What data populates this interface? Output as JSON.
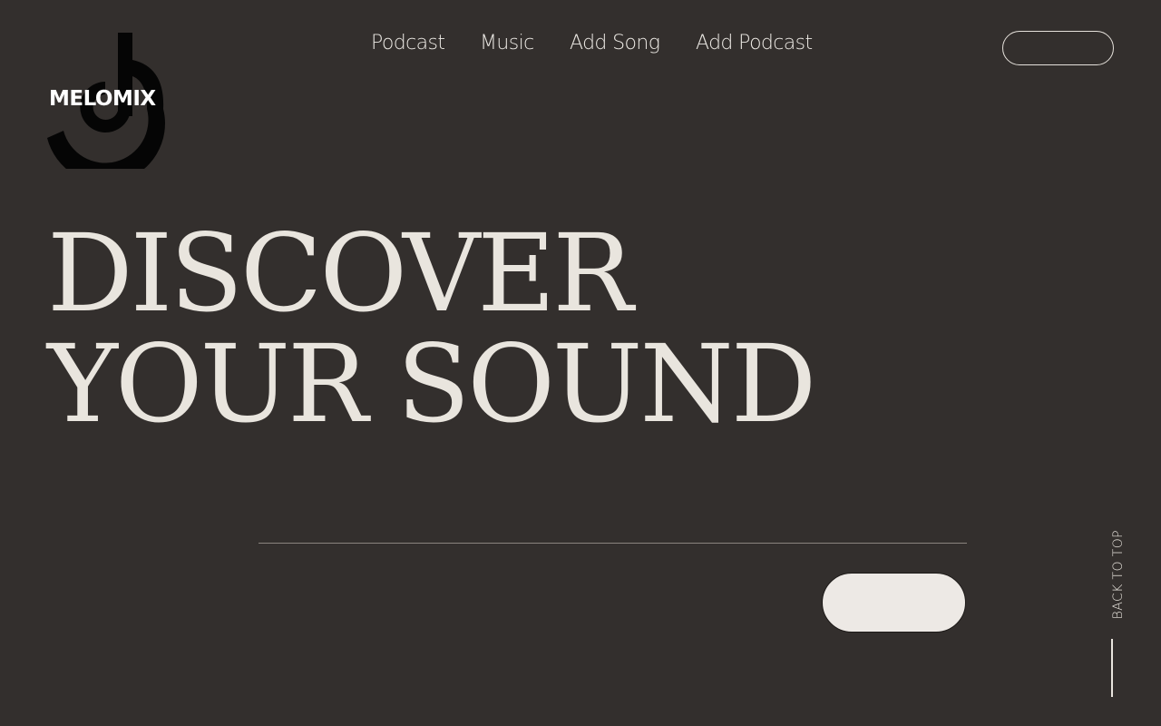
{
  "brand": {
    "name": "MELOMIX",
    "logo_icon": "dj-letters-icon"
  },
  "nav": {
    "items": [
      {
        "label": "Podcast"
      },
      {
        "label": "Music"
      },
      {
        "label": "Add Song"
      },
      {
        "label": "Add Podcast"
      }
    ]
  },
  "hero": {
    "line1": "DISCOVER",
    "line2": "YOUR SOUND"
  },
  "back_to_top": {
    "label": "BACK TO TOP"
  },
  "colors": {
    "background": "#332f2d",
    "text": "#e9e5de",
    "button_fill": "#ede9e5"
  }
}
